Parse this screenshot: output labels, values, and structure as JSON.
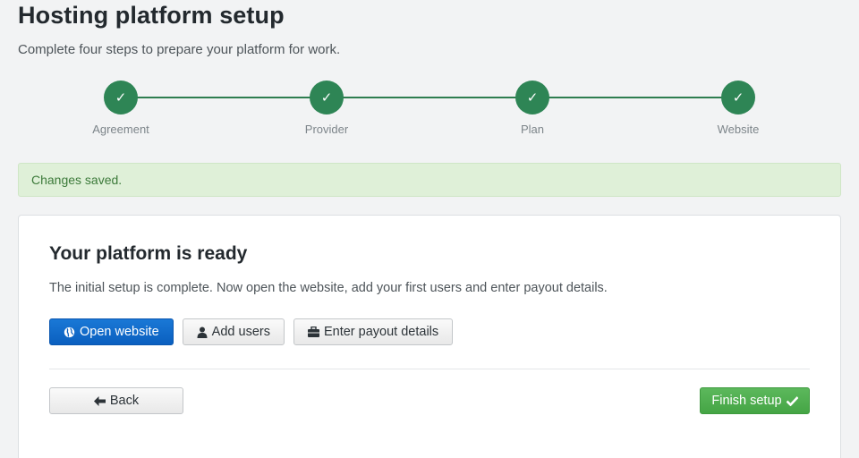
{
  "header": {
    "title": "Hosting platform setup",
    "subtitle": "Complete four steps to prepare your platform for work."
  },
  "stepper": {
    "check_glyph": "✓",
    "steps": [
      {
        "label": "Agreement",
        "status": "complete"
      },
      {
        "label": "Provider",
        "status": "complete"
      },
      {
        "label": "Plan",
        "status": "complete"
      },
      {
        "label": "Website",
        "status": "complete"
      }
    ]
  },
  "alert": {
    "text": "Changes saved."
  },
  "card": {
    "title": "Your platform is ready",
    "text": "The initial setup is complete. Now open the website, add your first users and enter payout details.",
    "actions": {
      "open_website": {
        "label": "Open website",
        "icon": "globe-icon"
      },
      "add_users": {
        "label": "Add users",
        "icon": "user-icon"
      },
      "payout": {
        "label": "Enter payout details",
        "icon": "briefcase-icon"
      }
    },
    "back": {
      "label": "Back",
      "icon": "arrow-left-icon"
    },
    "finish": {
      "label": "Finish setup",
      "icon": "checkmark-icon"
    }
  },
  "colors": {
    "step_complete": "#2e8555",
    "primary": "#0a5fbf",
    "success": "#5cb85c",
    "alert_bg": "#dff0d8"
  }
}
